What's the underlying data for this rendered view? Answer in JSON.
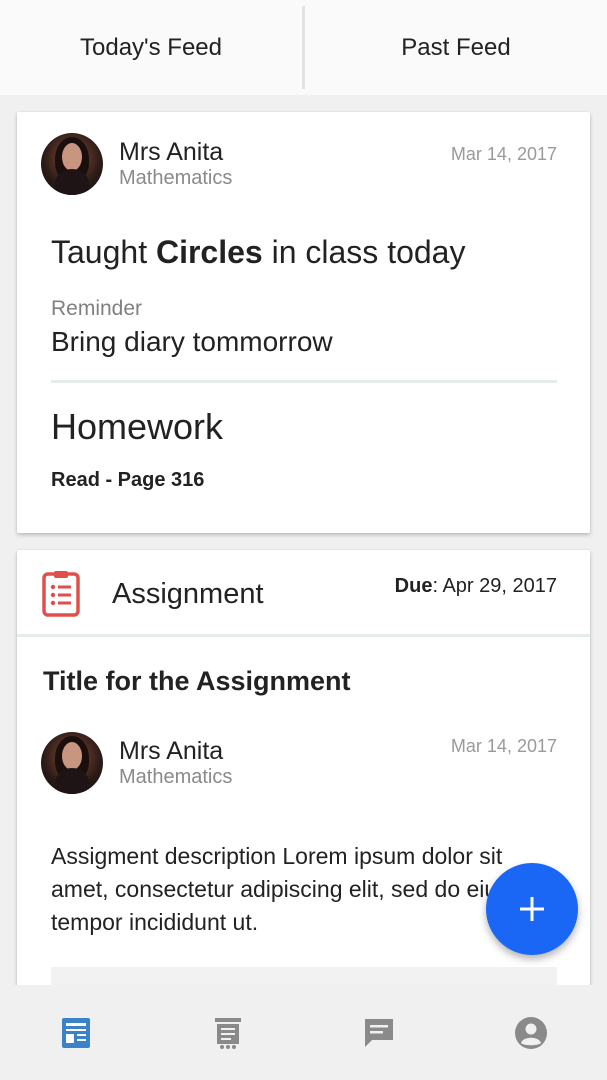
{
  "tabs": [
    {
      "label": "Today's Feed"
    },
    {
      "label": "Past Feed"
    }
  ],
  "feed_card": {
    "author_name": "Mrs Anita",
    "author_subject": "Mathematics",
    "date": "Mar 14, 2017",
    "taught_prefix": "Taught ",
    "taught_topic": "Circles",
    "taught_suffix": " in class today",
    "reminder_label": "Reminder",
    "reminder_text": "Bring diary tommorrow",
    "homework_title": "Homework",
    "homework_text": "Read - Page 316"
  },
  "assignment_card": {
    "label": "Assignment",
    "due_label": "Due",
    "due_date": ": Apr 29, 2017",
    "title": "Title for the Assignment",
    "author_name": "Mrs Anita",
    "author_subject": "Mathematics",
    "date": "Mar 14, 2017",
    "description": "Assigment description Lorem ipsum dolor sit amet, consectetur adipiscing elit, sed do eiusmod tempor incididunt ut."
  },
  "fab": {
    "icon": "plus-icon"
  },
  "bottom_nav": {
    "items": [
      {
        "icon": "feed-icon",
        "active": true
      },
      {
        "icon": "receipt-icon",
        "active": false
      },
      {
        "icon": "message-icon",
        "active": false
      },
      {
        "icon": "account-icon",
        "active": false
      }
    ]
  },
  "colors": {
    "accent": "#1a66f5",
    "active_nav": "#3b82c9",
    "inactive_nav": "#8a8a8a",
    "assignment_icon": "#e0504a"
  }
}
